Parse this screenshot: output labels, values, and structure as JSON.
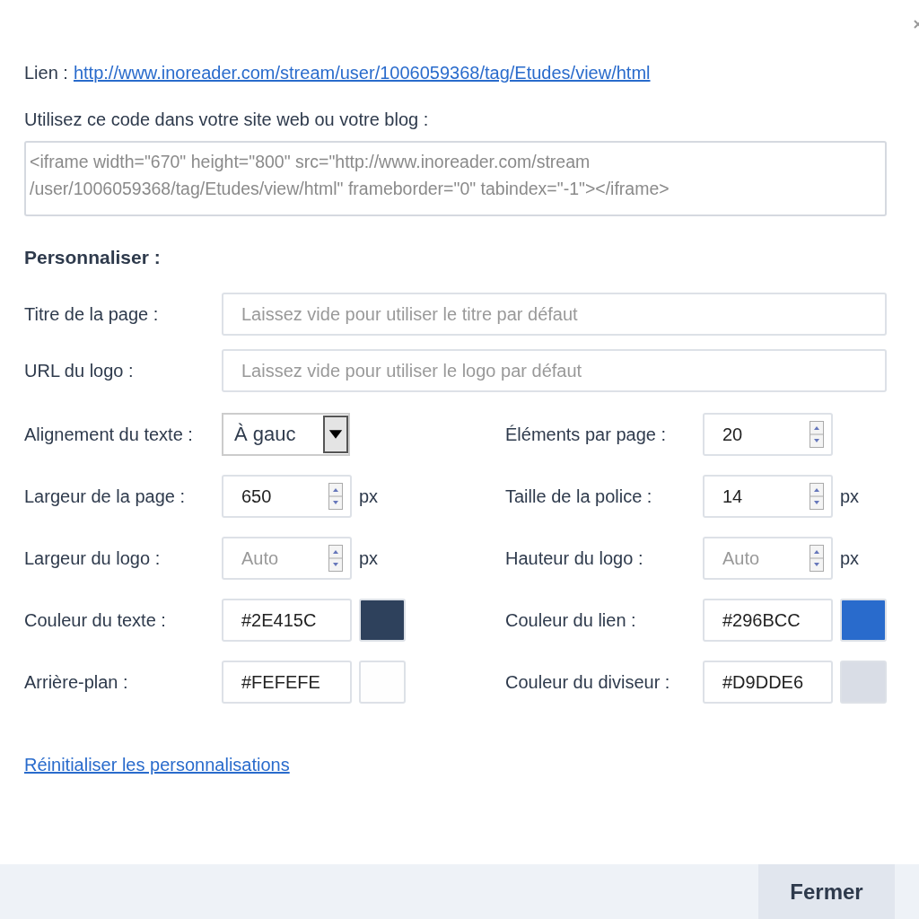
{
  "link": {
    "label": "Lien :",
    "url": "http://www.inoreader.com/stream/user/1006059368/tag/Etudes/view/html"
  },
  "embed": {
    "label": "Utilisez ce code dans votre site web ou votre blog :",
    "code": "<iframe width=\"670\" height=\"800\" src=\"http://www.inoreader.com/stream /user/1006059368/tag/Etudes/view/html\" frameborder=\"0\" tabindex=\"-1\"></iframe>"
  },
  "customize": {
    "heading": "Personnaliser :",
    "text_fields": [
      {
        "label": "Titre de la page :",
        "placeholder": "Laissez vide pour utiliser le titre par défaut"
      },
      {
        "label": "URL du logo :",
        "placeholder": "Laissez vide pour utiliser le logo par défaut"
      }
    ],
    "fields": [
      {
        "kind": "select",
        "label": "Alignement du texte :",
        "value": "À gauc"
      },
      {
        "kind": "spinner",
        "label": "Éléments par page :",
        "value": "20"
      },
      {
        "kind": "spinner",
        "label": "Largeur de la page :",
        "value": "650",
        "unit": "px"
      },
      {
        "kind": "spinner",
        "label": "Taille de la police :",
        "value": "14",
        "unit": "px"
      },
      {
        "kind": "spinner",
        "label": "Largeur du logo :",
        "placeholder": "Auto",
        "unit": "px"
      },
      {
        "kind": "spinner",
        "label": "Hauteur du logo :",
        "placeholder": "Auto",
        "unit": "px"
      },
      {
        "kind": "color",
        "label": "Couleur du texte :",
        "value": "#2E415C",
        "color": "#2e415c"
      },
      {
        "kind": "color",
        "label": "Couleur du lien :",
        "value": "#296BCC",
        "color": "#296bcc"
      },
      {
        "kind": "color",
        "label": "Arrière-plan :",
        "value": "#FEFEFE",
        "color": "#fefefe"
      },
      {
        "kind": "color",
        "label": "Couleur du diviseur :",
        "value": "#D9DDE6",
        "color": "#d9dde6"
      }
    ],
    "reset_link": "Réinitialiser les personnalisations"
  },
  "buttons": [
    "Fermer"
  ]
}
